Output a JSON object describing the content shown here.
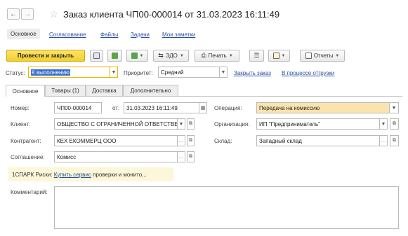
{
  "window": {
    "title": "Заказ клиента ЧП00-000014 от 31.03.2023 16:11:49",
    "back_glyph": "←",
    "forward_glyph": "→",
    "star_glyph": "☆"
  },
  "sections": [
    "Основное",
    "Согласование",
    "Файлы",
    "Задачи",
    "Мои заметки"
  ],
  "toolbar": {
    "post_close": "Провести и закрыть",
    "edo": "ЭДО",
    "print": "Печать",
    "reports": "Отчеты"
  },
  "status": {
    "label": "Статус:",
    "value": "К выполнению",
    "priority_label": "Приоритет:",
    "priority_value": "Средний",
    "close_order_link": "Закрыть заказ",
    "shipping_link": "В процессе отгрузки"
  },
  "tabs": [
    "Основное",
    "Товары (1)",
    "Доставка",
    "Дополнительно"
  ],
  "form": {
    "number_label": "Номер:",
    "number_value": "ЧП00-000014",
    "date_label": "от:",
    "date_value": "31.03.2023 16:11:49",
    "operation_label": "Операция:",
    "operation_value": "Передача на комиссию",
    "client_label": "Клиент:",
    "client_value": "ОБЩЕСТВО С ОГРАНИЧЕННОЙ ОТВЕТСТВЕННОСТЬЮ",
    "org_label": "Организация:",
    "org_value": "ИП \"Предприниматель\"",
    "contractor_label": "Контрагент:",
    "contractor_value": "КЕХ ЕКОММЕРЦ ООО",
    "warehouse_label": "Склад:",
    "warehouse_value": "Западный склад",
    "agreement_label": "Соглашение:",
    "agreement_value": "Комисс",
    "comment_label": "Комментарий:"
  },
  "spark": {
    "prefix": "1СПАРК Риски:",
    "link": "Купить сервис",
    "suffix": "проверки и монито..."
  },
  "colors": {
    "primary_button": "#f4cf28",
    "status_border": "#e8b400",
    "link": "#2a4f9e",
    "operation_bg": "#fbe3ad",
    "info_bg": "#fcf7d9"
  }
}
